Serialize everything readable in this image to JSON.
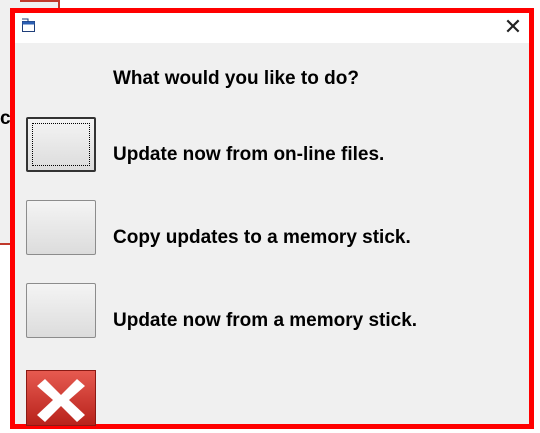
{
  "background_window": {
    "partial_text": "c"
  },
  "dialog": {
    "icons": {
      "app": "app-window-icon",
      "close": "close-icon",
      "exit": "red-x-icon"
    },
    "close_glyph": "✕",
    "prompt": "What would you like to do?",
    "options": [
      {
        "label": "Update now from on-line files.",
        "focused": true
      },
      {
        "label": "Copy updates to a memory stick.",
        "focused": false
      },
      {
        "label": "Update now from a memory stick.",
        "focused": false
      }
    ]
  },
  "colors": {
    "highlight_border": "#ff0000",
    "dialog_bg": "#f0f0f0",
    "exit_button": "#c8302a"
  }
}
